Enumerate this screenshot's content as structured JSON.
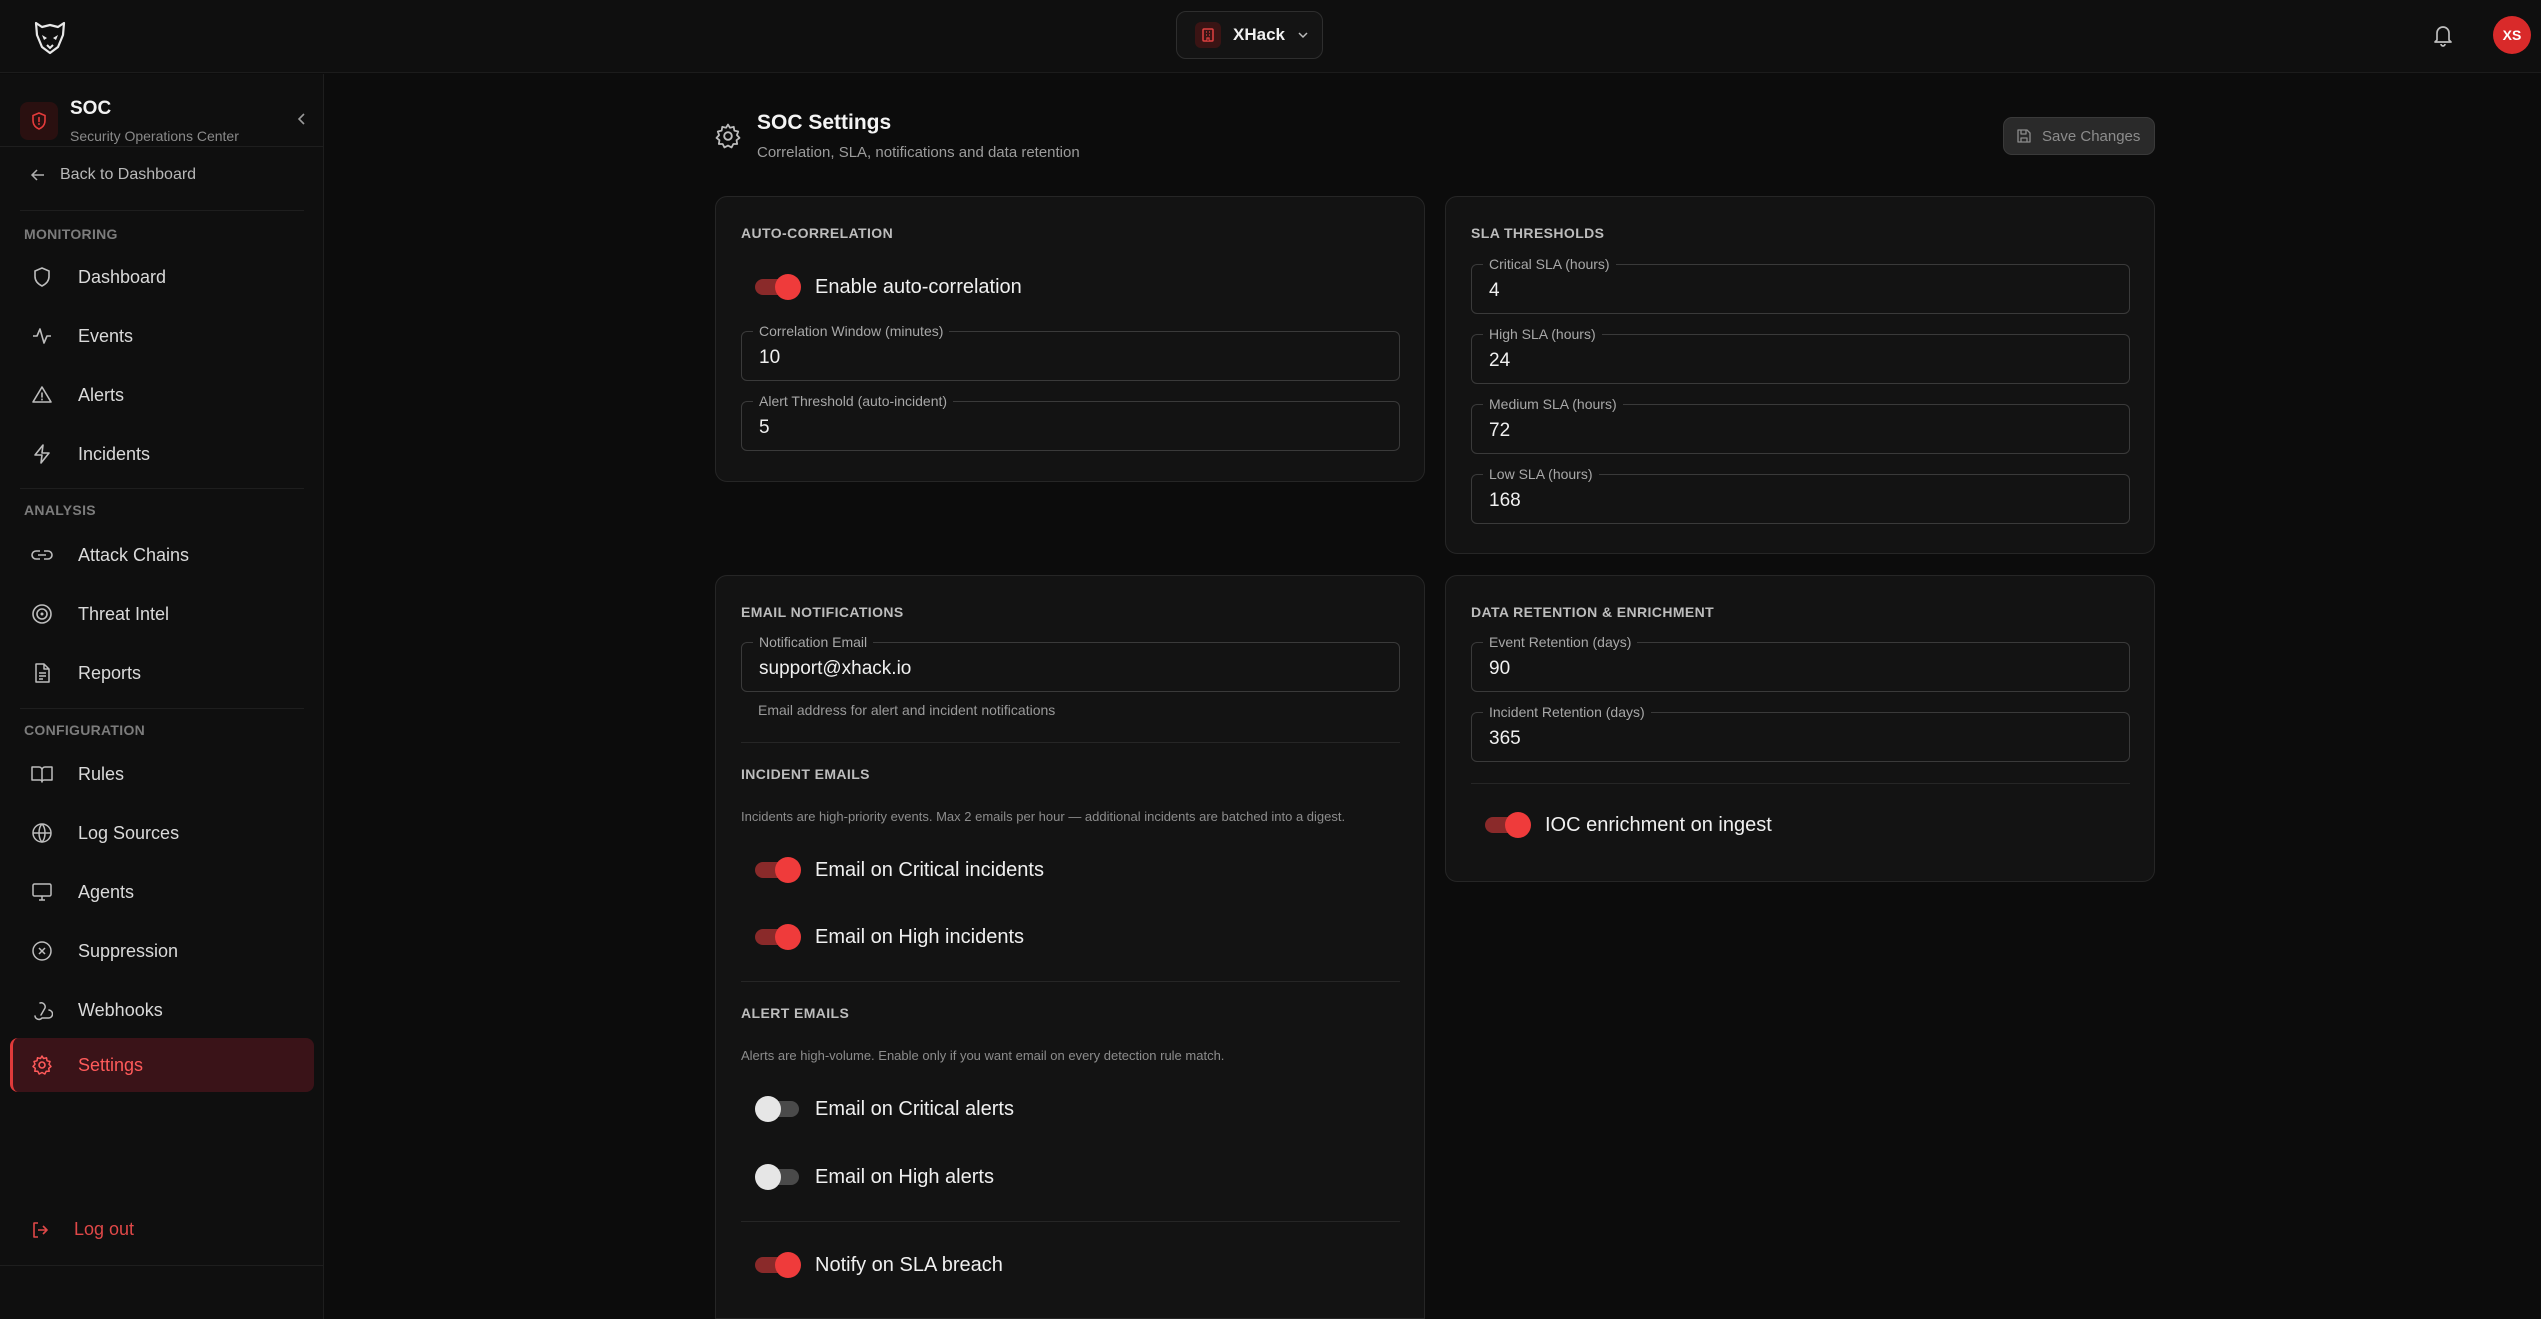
{
  "topbar": {
    "tenant_name": "XHack",
    "avatar_initials": "XS"
  },
  "sidebar": {
    "title": "SOC",
    "subtitle": "Security Operations Center",
    "back_label": "Back to Dashboard",
    "sections": {
      "monitoring": "MONITORING",
      "analysis": "ANALYSIS",
      "configuration": "CONFIGURATION"
    },
    "items": {
      "dashboard": "Dashboard",
      "events": "Events",
      "alerts": "Alerts",
      "incidents": "Incidents",
      "attack_chains": "Attack Chains",
      "threat_intel": "Threat Intel",
      "reports": "Reports",
      "rules": "Rules",
      "log_sources": "Log Sources",
      "agents": "Agents",
      "suppression": "Suppression",
      "webhooks": "Webhooks",
      "settings": "Settings"
    },
    "active_item": "settings",
    "logout_label": "Log out"
  },
  "page": {
    "title": "SOC Settings",
    "subtitle": "Correlation, SLA, notifications and data retention",
    "save_label": "Save Changes"
  },
  "auto_correlation": {
    "title": "AUTO-CORRELATION",
    "enable_label": "Enable auto-correlation",
    "enabled": true,
    "window_label": "Correlation Window (minutes)",
    "window_value": "10",
    "threshold_label": "Alert Threshold (auto-incident)",
    "threshold_value": "5"
  },
  "sla": {
    "title": "SLA THRESHOLDS",
    "critical_label": "Critical SLA (hours)",
    "critical_value": "4",
    "high_label": "High SLA (hours)",
    "high_value": "24",
    "medium_label": "Medium SLA (hours)",
    "medium_value": "72",
    "low_label": "Low SLA (hours)",
    "low_value": "168"
  },
  "email": {
    "title": "EMAIL NOTIFICATIONS",
    "email_label": "Notification Email",
    "email_value": "support@xhack.io",
    "email_hint": "Email address for alert and incident notifications",
    "incident_title": "INCIDENT EMAILS",
    "incident_desc": "Incidents are high-priority events. Max 2 emails per hour — additional incidents are batched into a digest.",
    "critical_incidents_label": "Email on Critical incidents",
    "critical_incidents_on": true,
    "high_incidents_label": "Email on High incidents",
    "high_incidents_on": true,
    "alert_title": "ALERT EMAILS",
    "alert_desc": "Alerts are high-volume. Enable only if you want email on every detection rule match.",
    "critical_alerts_label": "Email on Critical alerts",
    "critical_alerts_on": false,
    "high_alerts_label": "Email on High alerts",
    "high_alerts_on": false,
    "sla_breach_label": "Notify on SLA breach",
    "sla_breach_on": true
  },
  "retention": {
    "title": "DATA RETENTION & ENRICHMENT",
    "event_label": "Event Retention (days)",
    "event_value": "90",
    "incident_label": "Incident Retention (days)",
    "incident_value": "365",
    "ioc_label": "IOC enrichment on ingest",
    "ioc_on": true
  },
  "colors": {
    "accent": "#ef3b3b",
    "background": "#0c0c0c",
    "card": "#131313"
  }
}
